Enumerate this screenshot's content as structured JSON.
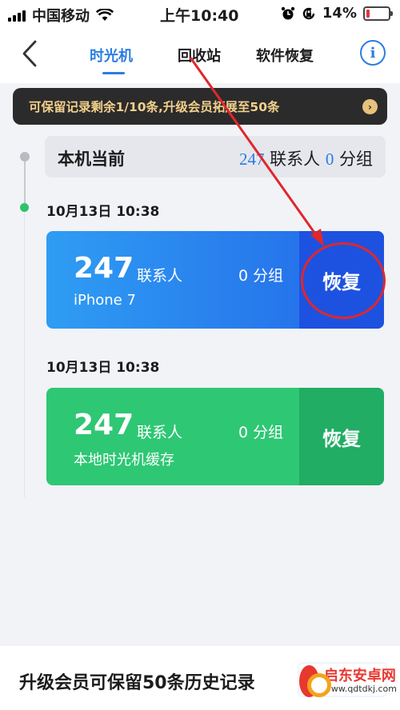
{
  "statusbar": {
    "carrier": "中国移动",
    "time": "上午10:40",
    "battery_pct": "14%",
    "battery_level": 0.14,
    "icons": [
      "signal-icon",
      "wifi-icon",
      "alarm-icon",
      "orientation-lock-icon",
      "battery-icon"
    ]
  },
  "navbar": {
    "tabs": [
      {
        "label": "时光机",
        "active": true
      },
      {
        "label": "回收站",
        "active": false
      },
      {
        "label": "软件恢复",
        "active": false
      }
    ],
    "info_label": "i",
    "accent_color": "#2a7de1"
  },
  "banner": {
    "text": "可保留记录剩余1/10条,升级会员拓展至50条"
  },
  "current": {
    "title": "本机当前",
    "contacts": "247",
    "contacts_label": "联系人",
    "groups": "0",
    "groups_label": "分组"
  },
  "records": [
    {
      "date": "10月13日  10:38",
      "count": "247",
      "count_label": "联系人",
      "groups": "0 分组",
      "source": "iPhone 7",
      "action": "恢复",
      "color": "#2366e8"
    },
    {
      "date": "10月13日  10:38",
      "count": "247",
      "count_label": "联系人",
      "groups": "0 分组",
      "source": "本地时光机缓存",
      "action": "恢复",
      "color": "#2ec774"
    }
  ],
  "footer": {
    "text": "升级会员可保留50条历史记录"
  },
  "watermark": {
    "title": "启东安卓网",
    "url": "www.qdtdkj.com"
  }
}
